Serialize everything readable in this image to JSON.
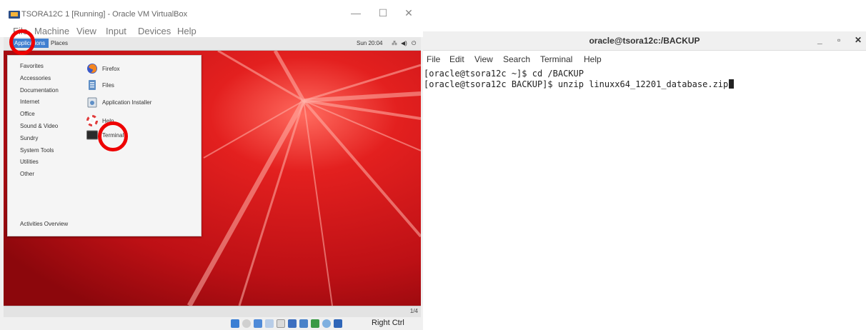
{
  "vbox": {
    "title": "TSORA12C 1 [Running] - Oracle VM VirtualBox",
    "menu": [
      "File",
      "Machine",
      "View",
      "Input",
      "Devices",
      "Help"
    ],
    "right_ctrl": "Right Ctrl",
    "pager": "1/4"
  },
  "guest": {
    "applications": "Applications",
    "places": "Places",
    "clock": "Sun 20:04",
    "categories": [
      "Favorites",
      "Accessories",
      "Documentation",
      "Internet",
      "Office",
      "Sound & Video",
      "Sundry",
      "System Tools",
      "Utilities",
      "Other"
    ],
    "apps": [
      "Firefox",
      "Files",
      "Application Installer",
      "Help",
      "Terminal"
    ],
    "activities": "Activities Overview"
  },
  "terminal": {
    "title": "oracle@tsora12c:/BACKUP",
    "menu": [
      "File",
      "Edit",
      "View",
      "Search",
      "Terminal",
      "Help"
    ],
    "lines": [
      "[oracle@tsora12c ~]$ cd /BACKUP",
      "[oracle@tsora12c BACKUP]$ unzip linuxx64_12201_database.zip"
    ]
  },
  "colors": {
    "accent": "#3f7fd0",
    "wallpaper": "#c4141b",
    "annotation": "#ee0000"
  }
}
